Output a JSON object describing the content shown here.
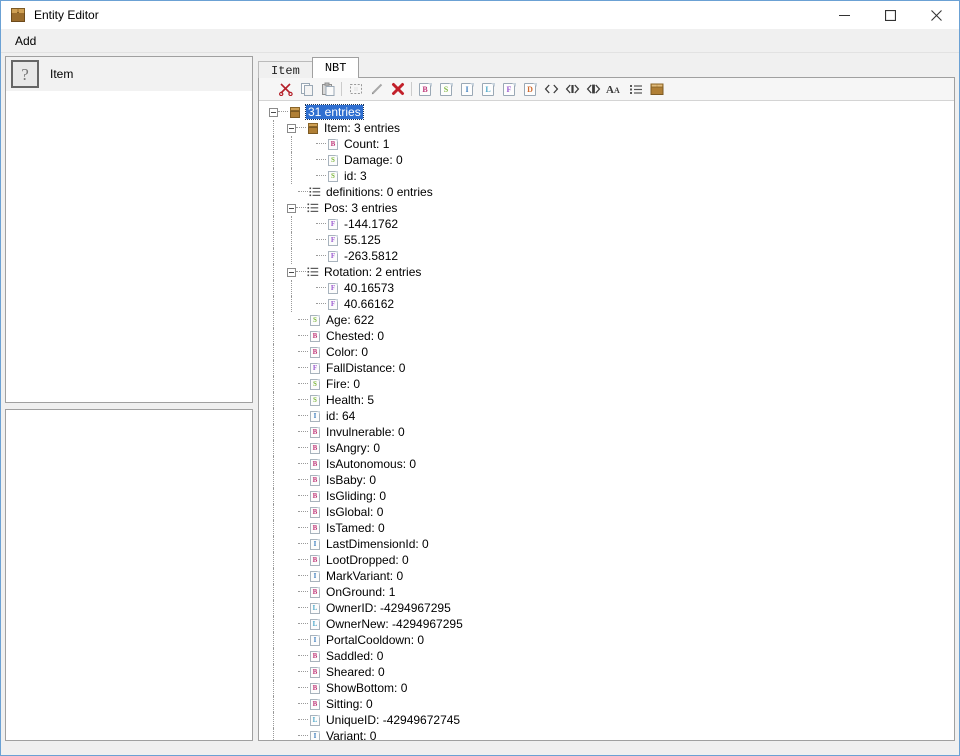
{
  "window": {
    "title": "Entity Editor",
    "app_icon": "crate-icon",
    "minimize": "–",
    "maximize": "□",
    "close": "×"
  },
  "menubar": {
    "items": [
      {
        "label": "Add",
        "name": "menu-add"
      }
    ]
  },
  "sidebar": {
    "entities": [
      {
        "label": "Item",
        "icon": "question-mark-thumb",
        "selected": true
      }
    ]
  },
  "tabs": [
    {
      "label": "Item",
      "name": "tab-item",
      "active": false
    },
    {
      "label": "NBT",
      "name": "tab-nbt",
      "active": true
    }
  ],
  "toolbar": {
    "buttons": [
      {
        "name": "cut-button",
        "icon": "scissors-icon",
        "label": "Cut"
      },
      {
        "name": "copy-button",
        "icon": "copy-icon",
        "label": "Copy"
      },
      {
        "name": "paste-button",
        "icon": "paste-icon",
        "label": "Paste"
      },
      {
        "name": "separator-1",
        "icon": "separator",
        "label": ""
      },
      {
        "name": "select-button",
        "icon": "marquee-select-icon",
        "label": "Select"
      },
      {
        "name": "edit-button",
        "icon": "pencil-icon",
        "label": "Edit"
      },
      {
        "name": "delete-button",
        "icon": "delete-x-icon",
        "label": "Delete"
      },
      {
        "name": "separator-2",
        "icon": "separator",
        "label": ""
      },
      {
        "name": "add-byte-button",
        "icon": "doc-b-icon",
        "label": "B",
        "color": "#c0397a"
      },
      {
        "name": "add-short-button",
        "icon": "doc-s-icon",
        "label": "S",
        "color": "#7fb83f"
      },
      {
        "name": "add-int-button",
        "icon": "doc-i-icon",
        "label": "I",
        "color": "#3f7fc0"
      },
      {
        "name": "add-long-button",
        "icon": "doc-l-icon",
        "label": "L",
        "color": "#4fa8c9"
      },
      {
        "name": "add-float-button",
        "icon": "doc-f-icon",
        "label": "F",
        "color": "#9b59d0"
      },
      {
        "name": "add-double-button",
        "icon": "doc-d-icon",
        "label": "D",
        "color": "#d06a2f"
      },
      {
        "name": "add-bytearray-button",
        "icon": "angle-brackets-icon",
        "label": "Byte Array"
      },
      {
        "name": "add-intarray-button",
        "icon": "angle-brackets-filled-icon",
        "label": "Int Array"
      },
      {
        "name": "add-longarray-button",
        "icon": "angle-brackets-filled2-icon",
        "label": "Long Array"
      },
      {
        "name": "add-string-button",
        "icon": "text-aa-icon",
        "label": "String"
      },
      {
        "name": "add-list-button",
        "icon": "list-icon",
        "label": "List"
      },
      {
        "name": "add-compound-button",
        "icon": "crate-icon",
        "label": "Compound"
      }
    ]
  },
  "tree": {
    "nodes": [
      {
        "depth": 0,
        "twisty": "expanded",
        "icon": "compound",
        "letter": "",
        "color": "",
        "label": "31 entries",
        "selected": true
      },
      {
        "depth": 1,
        "twisty": "expanded",
        "icon": "compound",
        "letter": "",
        "color": "",
        "label": "Item: 3 entries",
        "selected": false
      },
      {
        "depth": 2,
        "twisty": "none",
        "icon": "doc",
        "letter": "B",
        "color": "#c0397a",
        "label": "Count: 1",
        "selected": false
      },
      {
        "depth": 2,
        "twisty": "none",
        "icon": "doc",
        "letter": "S",
        "color": "#7fb83f",
        "label": "Damage: 0",
        "selected": false
      },
      {
        "depth": 2,
        "twisty": "last",
        "icon": "doc",
        "letter": "S",
        "color": "#7fb83f",
        "label": "id: 3",
        "selected": false
      },
      {
        "depth": 1,
        "twisty": "none",
        "icon": "list",
        "letter": "",
        "color": "",
        "label": "definitions: 0 entries",
        "selected": false
      },
      {
        "depth": 1,
        "twisty": "expanded",
        "icon": "list",
        "letter": "",
        "color": "",
        "label": "Pos: 3 entries",
        "selected": false
      },
      {
        "depth": 2,
        "twisty": "none",
        "icon": "doc",
        "letter": "F",
        "color": "#9b59d0",
        "label": "-144.1762",
        "selected": false
      },
      {
        "depth": 2,
        "twisty": "none",
        "icon": "doc",
        "letter": "F",
        "color": "#9b59d0",
        "label": "55.125",
        "selected": false
      },
      {
        "depth": 2,
        "twisty": "last",
        "icon": "doc",
        "letter": "F",
        "color": "#9b59d0",
        "label": "-263.5812",
        "selected": false
      },
      {
        "depth": 1,
        "twisty": "expanded",
        "icon": "list",
        "letter": "",
        "color": "",
        "label": "Rotation: 2 entries",
        "selected": false
      },
      {
        "depth": 2,
        "twisty": "none",
        "icon": "doc",
        "letter": "F",
        "color": "#9b59d0",
        "label": "40.16573",
        "selected": false
      },
      {
        "depth": 2,
        "twisty": "last",
        "icon": "doc",
        "letter": "F",
        "color": "#9b59d0",
        "label": "40.66162",
        "selected": false
      },
      {
        "depth": 1,
        "twisty": "none",
        "icon": "doc",
        "letter": "S",
        "color": "#7fb83f",
        "label": "Age: 622",
        "selected": false
      },
      {
        "depth": 1,
        "twisty": "none",
        "icon": "doc",
        "letter": "B",
        "color": "#c0397a",
        "label": "Chested: 0",
        "selected": false
      },
      {
        "depth": 1,
        "twisty": "none",
        "icon": "doc",
        "letter": "B",
        "color": "#c0397a",
        "label": "Color: 0",
        "selected": false
      },
      {
        "depth": 1,
        "twisty": "none",
        "icon": "doc",
        "letter": "F",
        "color": "#9b59d0",
        "label": "FallDistance: 0",
        "selected": false
      },
      {
        "depth": 1,
        "twisty": "none",
        "icon": "doc",
        "letter": "S",
        "color": "#7fb83f",
        "label": "Fire: 0",
        "selected": false
      },
      {
        "depth": 1,
        "twisty": "none",
        "icon": "doc",
        "letter": "S",
        "color": "#7fb83f",
        "label": "Health: 5",
        "selected": false
      },
      {
        "depth": 1,
        "twisty": "none",
        "icon": "doc",
        "letter": "I",
        "color": "#3f7fc0",
        "label": "id: 64",
        "selected": false
      },
      {
        "depth": 1,
        "twisty": "none",
        "icon": "doc",
        "letter": "B",
        "color": "#c0397a",
        "label": "Invulnerable: 0",
        "selected": false
      },
      {
        "depth": 1,
        "twisty": "none",
        "icon": "doc",
        "letter": "B",
        "color": "#c0397a",
        "label": "IsAngry: 0",
        "selected": false
      },
      {
        "depth": 1,
        "twisty": "none",
        "icon": "doc",
        "letter": "B",
        "color": "#c0397a",
        "label": "IsAutonomous: 0",
        "selected": false
      },
      {
        "depth": 1,
        "twisty": "none",
        "icon": "doc",
        "letter": "B",
        "color": "#c0397a",
        "label": "IsBaby: 0",
        "selected": false
      },
      {
        "depth": 1,
        "twisty": "none",
        "icon": "doc",
        "letter": "B",
        "color": "#c0397a",
        "label": "IsGliding: 0",
        "selected": false
      },
      {
        "depth": 1,
        "twisty": "none",
        "icon": "doc",
        "letter": "B",
        "color": "#c0397a",
        "label": "IsGlobal: 0",
        "selected": false
      },
      {
        "depth": 1,
        "twisty": "none",
        "icon": "doc",
        "letter": "B",
        "color": "#c0397a",
        "label": "IsTamed: 0",
        "selected": false
      },
      {
        "depth": 1,
        "twisty": "none",
        "icon": "doc",
        "letter": "I",
        "color": "#3f7fc0",
        "label": "LastDimensionId: 0",
        "selected": false
      },
      {
        "depth": 1,
        "twisty": "none",
        "icon": "doc",
        "letter": "B",
        "color": "#c0397a",
        "label": "LootDropped: 0",
        "selected": false
      },
      {
        "depth": 1,
        "twisty": "none",
        "icon": "doc",
        "letter": "I",
        "color": "#3f7fc0",
        "label": "MarkVariant: 0",
        "selected": false
      },
      {
        "depth": 1,
        "twisty": "none",
        "icon": "doc",
        "letter": "B",
        "color": "#c0397a",
        "label": "OnGround: 1",
        "selected": false
      },
      {
        "depth": 1,
        "twisty": "none",
        "icon": "doc",
        "letter": "L",
        "color": "#4fa8c9",
        "label": "OwnerID: -4294967295",
        "selected": false
      },
      {
        "depth": 1,
        "twisty": "none",
        "icon": "doc",
        "letter": "L",
        "color": "#4fa8c9",
        "label": "OwnerNew: -4294967295",
        "selected": false
      },
      {
        "depth": 1,
        "twisty": "none",
        "icon": "doc",
        "letter": "I",
        "color": "#3f7fc0",
        "label": "PortalCooldown: 0",
        "selected": false
      },
      {
        "depth": 1,
        "twisty": "none",
        "icon": "doc",
        "letter": "B",
        "color": "#c0397a",
        "label": "Saddled: 0",
        "selected": false
      },
      {
        "depth": 1,
        "twisty": "none",
        "icon": "doc",
        "letter": "B",
        "color": "#c0397a",
        "label": "Sheared: 0",
        "selected": false
      },
      {
        "depth": 1,
        "twisty": "none",
        "icon": "doc",
        "letter": "B",
        "color": "#c0397a",
        "label": "ShowBottom: 0",
        "selected": false
      },
      {
        "depth": 1,
        "twisty": "none",
        "icon": "doc",
        "letter": "B",
        "color": "#c0397a",
        "label": "Sitting: 0",
        "selected": false
      },
      {
        "depth": 1,
        "twisty": "none",
        "icon": "doc",
        "letter": "L",
        "color": "#4fa8c9",
        "label": "UniqueID: -42949672745",
        "selected": false
      },
      {
        "depth": 1,
        "twisty": "last",
        "icon": "doc",
        "letter": "I",
        "color": "#3f7fc0",
        "label": "Variant: 0",
        "selected": false
      }
    ]
  }
}
